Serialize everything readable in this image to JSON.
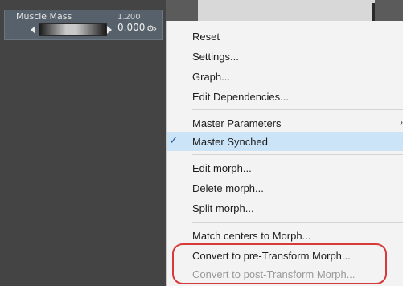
{
  "parameter": {
    "label": "Muscle Mass",
    "max_value": "1.200",
    "current_value": "0.000",
    "options_icon": "gear-icon"
  },
  "menu": {
    "items": [
      {
        "label": "Reset"
      },
      {
        "label": "Settings..."
      },
      {
        "label": "Graph..."
      },
      {
        "label": "Edit Dependencies..."
      },
      {
        "label": "Master Parameters",
        "submenu_arrow": "›"
      },
      {
        "label": "Master Synched",
        "check": "✓"
      },
      {
        "label": "Edit morph..."
      },
      {
        "label": "Delete morph..."
      },
      {
        "label": "Split morph..."
      },
      {
        "label": "Match centers to Morph..."
      },
      {
        "label": "Convert to pre-Transform Morph..."
      },
      {
        "label": "Convert to post-Transform Morph..."
      }
    ]
  },
  "colors": {
    "highlight_ring": "#d63a3a",
    "checked_background": "#cce4f7"
  }
}
